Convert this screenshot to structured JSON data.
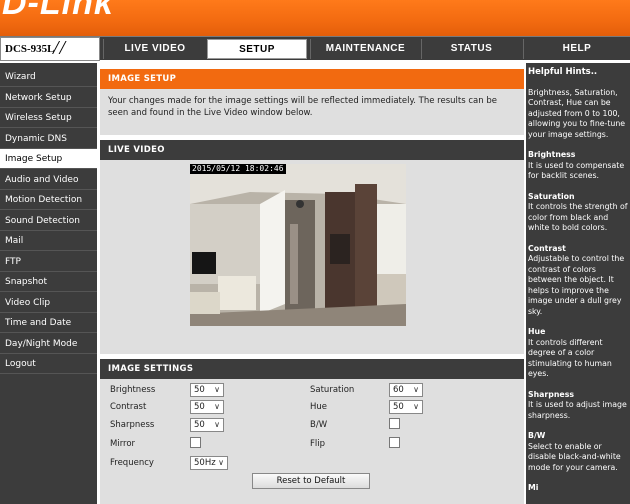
{
  "brand": {
    "logo_text": "D-Link"
  },
  "nav": {
    "model": "DCS-935L",
    "tabs": [
      {
        "label": "LIVE VIDEO"
      },
      {
        "label": "SETUP"
      },
      {
        "label": "MAINTENANCE"
      },
      {
        "label": "STATUS"
      },
      {
        "label": "HELP"
      }
    ],
    "active_tab": "SETUP"
  },
  "sidebar": {
    "items": [
      {
        "label": "Wizard"
      },
      {
        "label": "Network Setup"
      },
      {
        "label": "Wireless Setup"
      },
      {
        "label": "Dynamic DNS"
      },
      {
        "label": "Image Setup"
      },
      {
        "label": "Audio and Video"
      },
      {
        "label": "Motion Detection"
      },
      {
        "label": "Sound Detection"
      },
      {
        "label": "Mail"
      },
      {
        "label": "FTP"
      },
      {
        "label": "Snapshot"
      },
      {
        "label": "Video Clip"
      },
      {
        "label": "Time and Date"
      },
      {
        "label": "Day/Night Mode"
      },
      {
        "label": "Logout"
      }
    ],
    "active_item": "Image Setup"
  },
  "image_setup": {
    "title": "IMAGE SETUP",
    "description": "Your changes made for the image settings will be reflected immediately. The results can be seen and found in the Live Video window below."
  },
  "live_video": {
    "title": "LIVE VIDEO",
    "timestamp": "2015/05/12 18:02:46"
  },
  "image_settings": {
    "title": "IMAGE SETTINGS",
    "brightness": {
      "label": "Brightness",
      "value": "50"
    },
    "contrast": {
      "label": "Contrast",
      "value": "50"
    },
    "sharpness": {
      "label": "Sharpness",
      "value": "50"
    },
    "mirror": {
      "label": "Mirror",
      "checked": false
    },
    "frequency": {
      "label": "Frequency",
      "value": "50Hz"
    },
    "saturation": {
      "label": "Saturation",
      "value": "60"
    },
    "hue": {
      "label": "Hue",
      "value": "50"
    },
    "bw": {
      "label": "B/W",
      "checked": false
    },
    "flip": {
      "label": "Flip",
      "checked": false
    },
    "reset_label": "Reset to Default"
  },
  "help": {
    "title": "Helpful Hints..",
    "intro": "Brightness, Saturation, Contrast, Hue can be adjusted from 0 to 100, allowing you to fine-tune your image settings.",
    "hints": [
      {
        "heading": "Brightness",
        "body": "It is used to compensate for backlit scenes."
      },
      {
        "heading": "Saturation",
        "body": "It controls the strength of color from black and white to bold colors."
      },
      {
        "heading": "Contrast",
        "body": "Adjustable to control the contrast of colors between the object. It helps to improve the image under a dull grey sky."
      },
      {
        "heading": "Hue",
        "body": "It controls different degree of a color stimulating to human eyes."
      },
      {
        "heading": "Sharpness",
        "body": "It is used to adjust image sharpness."
      },
      {
        "heading": "B/W",
        "body": "Select to enable or disable black-and-white mode for your camera."
      },
      {
        "heading": "Mi",
        "body": ""
      }
    ]
  },
  "colors": {
    "brand_orange": "#f26a10",
    "nav_dark": "#3c3c3c",
    "panel_grey": "#dfdfdf"
  }
}
